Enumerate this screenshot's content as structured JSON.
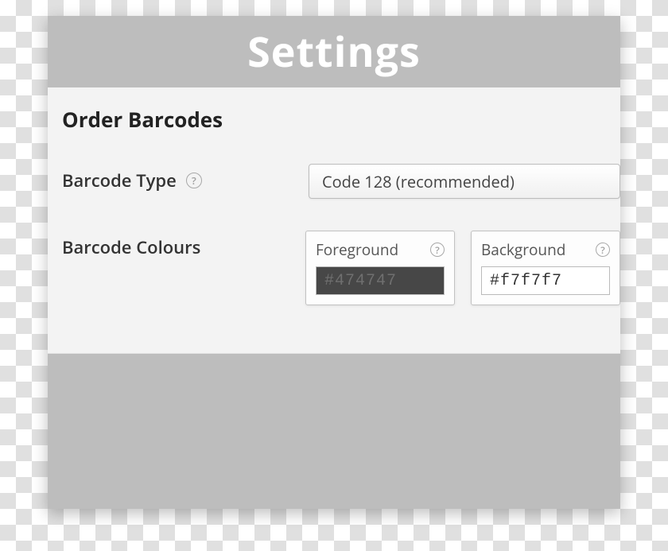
{
  "titlebar": {
    "title": "Settings"
  },
  "section": {
    "title": "Order Barcodes"
  },
  "barcode_type": {
    "label": "Barcode Type",
    "selected": "Code 128 (recommended)"
  },
  "barcode_colours": {
    "label": "Barcode Colours",
    "foreground": {
      "label": "Foreground",
      "value": "#474747"
    },
    "background": {
      "label": "Background",
      "value": "#f7f7f7"
    }
  },
  "glyphs": {
    "help": "?"
  }
}
